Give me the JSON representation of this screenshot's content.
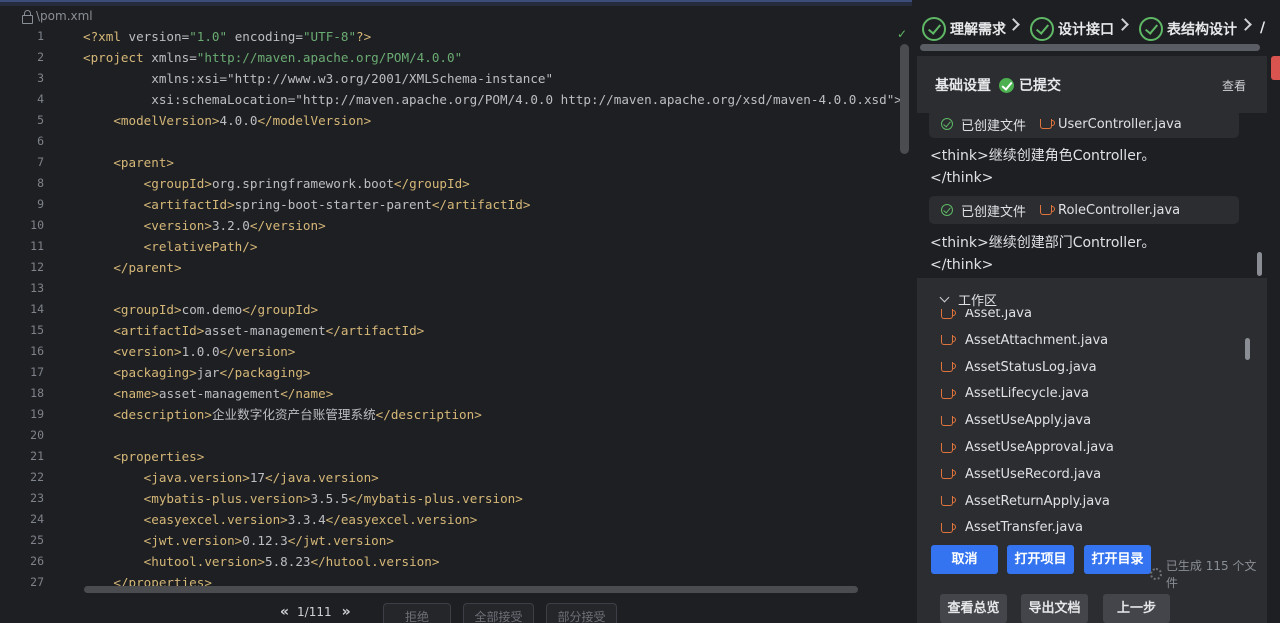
{
  "editor": {
    "file_name": "\\pom.xml",
    "line_numbers": [
      "1",
      "2",
      "3",
      "4",
      "5",
      "6",
      "7",
      "8",
      "9",
      "10",
      "11",
      "12",
      "13",
      "14",
      "15",
      "16",
      "17",
      "18",
      "19",
      "20",
      "21",
      "22",
      "23",
      "24",
      "25",
      "26",
      "27"
    ],
    "code_lines": [
      "<?xml version=\"1.0\" encoding=\"UTF-8\"?>",
      "<project xmlns=\"http://maven.apache.org/POM/4.0.0\"",
      "         xmlns:xsi=\"http://www.w3.org/2001/XMLSchema-instance\"",
      "         xsi:schemaLocation=\"http://maven.apache.org/POM/4.0.0 http://maven.apache.org/xsd/maven-4.0.0.xsd\">",
      "    <modelVersion>4.0.0</modelVersion>",
      "",
      "    <parent>",
      "        <groupId>org.springframework.boot</groupId>",
      "        <artifactId>spring-boot-starter-parent</artifactId>",
      "        <version>3.2.0</version>",
      "        <relativePath/>",
      "    </parent>",
      "",
      "    <groupId>com.demo</groupId>",
      "    <artifactId>asset-management</artifactId>",
      "    <version>1.0.0</version>",
      "    <packaging>jar</packaging>",
      "    <name>asset-management</name>",
      "    <description>企业数字化资产台账管理系统</description>",
      "",
      "    <properties>",
      "        <java.version>17</java.version>",
      "        <mybatis-plus.version>3.5.5</mybatis-plus.version>",
      "        <easyexcel.version>3.3.4</easyexcel.version>",
      "        <jwt.version>0.12.3</jwt.version>",
      "        <hutool.version>5.8.23</hutool.version>",
      "    </properties>"
    ],
    "diff_nav": {
      "prev": "«",
      "count": "1/111",
      "next": "»",
      "reject_label": "拒绝",
      "accept_all_label": "全部接受",
      "accept_partial_label": "部分接受"
    }
  },
  "steps": [
    {
      "label": "理解需求"
    },
    {
      "label": "设计接口"
    },
    {
      "label": "表结构设计"
    }
  ],
  "steps_overflow": "/",
  "settings": {
    "title": "基础设置",
    "status": "已提交",
    "view_label": "查看"
  },
  "chat": {
    "messages": [
      {
        "type": "file",
        "action": "已创建文件",
        "file": "UserController.java"
      },
      {
        "type": "think",
        "lines": [
          "<think>继续创建角色Controller。",
          "</think>"
        ]
      },
      {
        "type": "file",
        "action": "已创建文件",
        "file": "RoleController.java"
      },
      {
        "type": "think",
        "lines": [
          "<think>继续创建部门Controller。",
          "</think>"
        ]
      }
    ]
  },
  "workspace": {
    "title": "工作区",
    "files": [
      "Asset.java",
      "AssetAttachment.java",
      "AssetStatusLog.java",
      "AssetLifecycle.java",
      "AssetUseApply.java",
      "AssetUseApproval.java",
      "AssetUseRecord.java",
      "AssetReturnApply.java",
      "AssetTransfer.java"
    ],
    "cancel_label": "取消",
    "open_project_label": "打开项目",
    "open_dir_label": "打开目录",
    "generated_info": "已生成 115 个文件",
    "overview_label": "查看总览",
    "export_label": "导出文档",
    "prev_label": "上一步"
  },
  "colors": {
    "accent": "#3574f0",
    "success": "#5fb865",
    "xml_tag": "#d5b778",
    "xml_value": "#6aab73",
    "xml_namespace": "#c77dbb",
    "java_icon": "#e0743d"
  }
}
